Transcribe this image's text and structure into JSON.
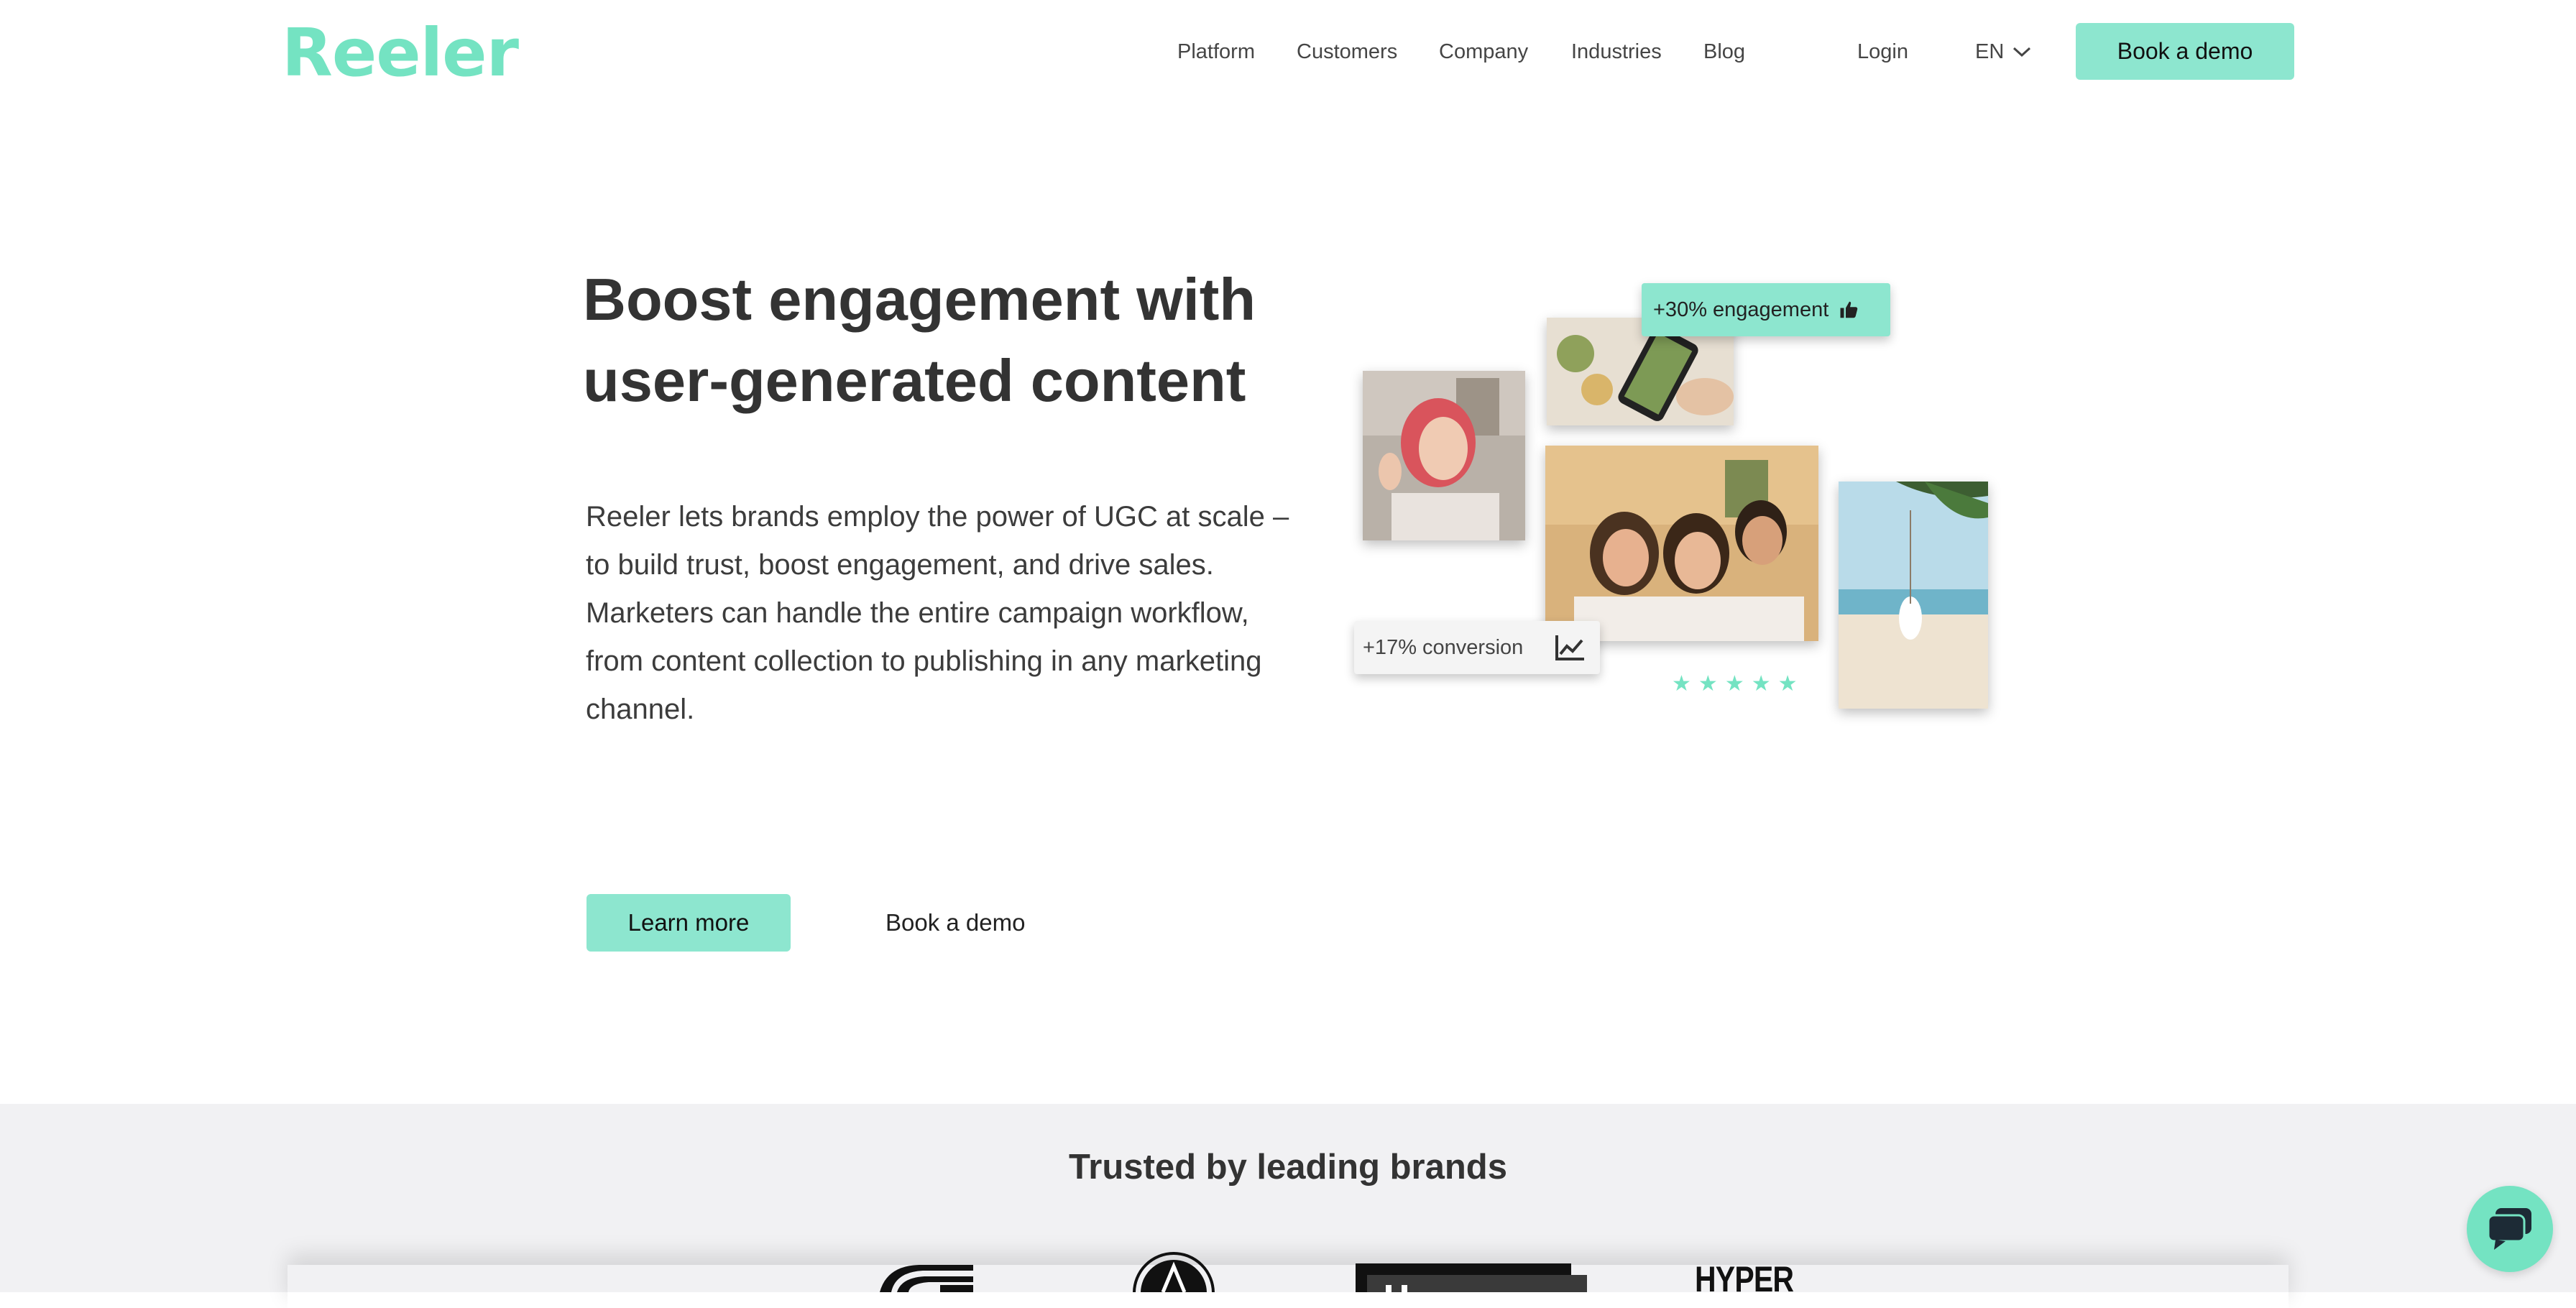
{
  "brand": {
    "logo_text": "Reeler",
    "accent": "#8de6cf",
    "logo_color": "#74e3c2"
  },
  "nav": {
    "items": [
      {
        "label": "Platform"
      },
      {
        "label": "Customers"
      },
      {
        "label": "Company"
      },
      {
        "label": "Industries"
      },
      {
        "label": "Blog"
      }
    ],
    "login": "Login",
    "language": "EN",
    "cta": "Book a demo"
  },
  "hero": {
    "title": "Boost engagement with user-generated content",
    "description": "Reeler lets brands employ the power of UGC at scale – to build trust, boost engagement, and drive sales. Marketers can handle the entire campaign workflow, from content collection to publishing in any marketing channel.",
    "primary_cta": "Learn more",
    "secondary_cta": "Book a demo"
  },
  "collage": {
    "engagement_badge": "+30% engagement",
    "conversion_badge": "+17% conversion",
    "rating_stars": 5
  },
  "trusted": {
    "title": "Trusted by leading brands",
    "partial_logo_text": "HYPER"
  },
  "icons": {
    "thumbs_up": "thumbs-up-icon",
    "chart": "trend-chart-icon",
    "chevron": "chevron-down-icon",
    "chat": "chat-icon"
  }
}
